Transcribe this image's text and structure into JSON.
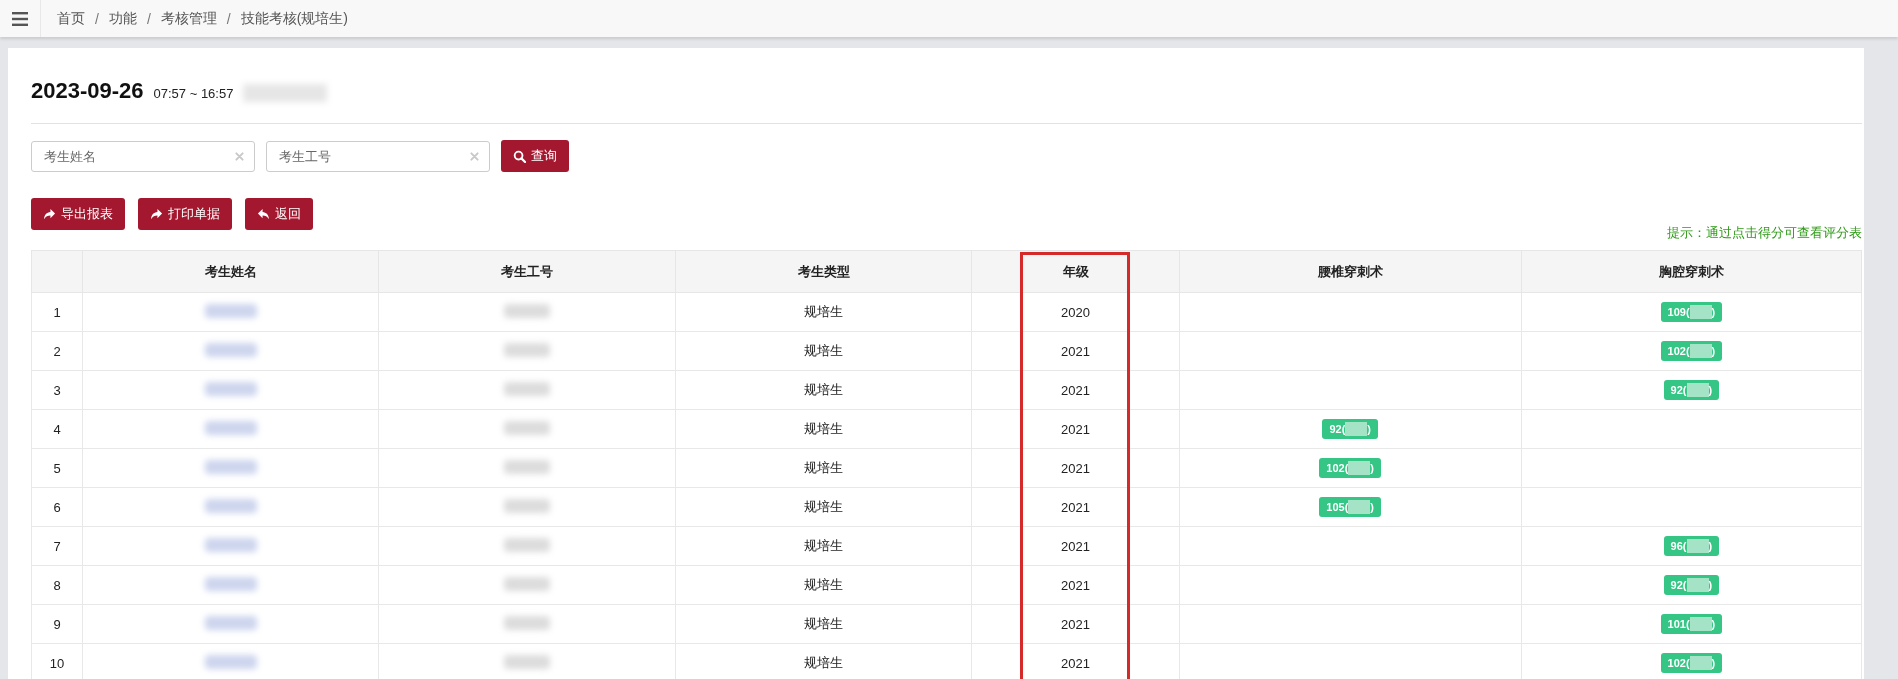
{
  "breadcrumb": [
    {
      "label": "首页"
    },
    {
      "separator": "/",
      "label": "功能"
    },
    {
      "separator": "/",
      "label": "考核管理"
    },
    {
      "separator": "/",
      "label": "技能考核(规培生)"
    }
  ],
  "header": {
    "date": "2023-09-26",
    "time_range": "07:57 ~ 16:57",
    "subtitle_redacted": true
  },
  "search": {
    "fields": [
      {
        "placeholder": "考生姓名"
      },
      {
        "placeholder": "考生工号"
      }
    ],
    "button": {
      "label": "查询"
    }
  },
  "actions": [
    {
      "label": "导出报表"
    },
    {
      "label": "打印单据"
    },
    {
      "label": "返回"
    }
  ],
  "hint": "提示：通过点击得分可查看评分表",
  "table": {
    "columns": [
      {
        "highlighted": false
      },
      {
        "label": "考生姓名",
        "highlighted": false
      },
      {
        "label": "考生工号",
        "highlighted": false
      },
      {
        "label": "考生类型",
        "highlighted": false
      },
      {
        "label": "年级",
        "highlighted": true
      },
      {
        "label": "腰椎穿刺术",
        "highlighted": false
      },
      {
        "label": "胸腔穿刺术",
        "highlighted": false
      }
    ],
    "rows": [
      {
        "cells": [
          {
            "kind": "text",
            "text": "1"
          },
          {
            "kind": "redacted"
          },
          {
            "kind": "redacted"
          },
          {
            "kind": "text",
            "text": "规培生"
          },
          {
            "kind": "text",
            "text": "2020"
          },
          {
            "kind": "blank"
          },
          {
            "kind": "score",
            "prefix": "109(",
            "suffix": ")"
          }
        ]
      },
      {
        "cells": [
          {
            "kind": "text",
            "text": "2"
          },
          {
            "kind": "redacted"
          },
          {
            "kind": "redacted"
          },
          {
            "kind": "text",
            "text": "规培生"
          },
          {
            "kind": "text",
            "text": "2021"
          },
          {
            "kind": "blank"
          },
          {
            "kind": "score",
            "prefix": "102(",
            "suffix": ")"
          }
        ]
      },
      {
        "cells": [
          {
            "kind": "text",
            "text": "3"
          },
          {
            "kind": "redacted"
          },
          {
            "kind": "redacted"
          },
          {
            "kind": "text",
            "text": "规培生"
          },
          {
            "kind": "text",
            "text": "2021"
          },
          {
            "kind": "blank"
          },
          {
            "kind": "score",
            "prefix": "92(",
            "suffix": ")"
          }
        ]
      },
      {
        "cells": [
          {
            "kind": "text",
            "text": "4"
          },
          {
            "kind": "redacted"
          },
          {
            "kind": "redacted"
          },
          {
            "kind": "text",
            "text": "规培生"
          },
          {
            "kind": "text",
            "text": "2021"
          },
          {
            "kind": "score",
            "prefix": "92(",
            "suffix": ")"
          },
          {
            "kind": "blank"
          }
        ]
      },
      {
        "cells": [
          {
            "kind": "text",
            "text": "5"
          },
          {
            "kind": "redacted"
          },
          {
            "kind": "redacted"
          },
          {
            "kind": "text",
            "text": "规培生"
          },
          {
            "kind": "text",
            "text": "2021"
          },
          {
            "kind": "score",
            "prefix": "102(",
            "suffix": ")"
          },
          {
            "kind": "blank"
          }
        ]
      },
      {
        "cells": [
          {
            "kind": "text",
            "text": "6"
          },
          {
            "kind": "redacted"
          },
          {
            "kind": "redacted"
          },
          {
            "kind": "text",
            "text": "规培生"
          },
          {
            "kind": "text",
            "text": "2021"
          },
          {
            "kind": "score",
            "prefix": "105(",
            "suffix": ")"
          },
          {
            "kind": "blank"
          }
        ]
      },
      {
        "cells": [
          {
            "kind": "text",
            "text": "7"
          },
          {
            "kind": "redacted"
          },
          {
            "kind": "redacted"
          },
          {
            "kind": "text",
            "text": "规培生"
          },
          {
            "kind": "text",
            "text": "2021"
          },
          {
            "kind": "blank"
          },
          {
            "kind": "score",
            "prefix": "96(",
            "suffix": ")"
          }
        ]
      },
      {
        "cells": [
          {
            "kind": "text",
            "text": "8"
          },
          {
            "kind": "redacted"
          },
          {
            "kind": "redacted"
          },
          {
            "kind": "text",
            "text": "规培生"
          },
          {
            "kind": "text",
            "text": "2021"
          },
          {
            "kind": "blank"
          },
          {
            "kind": "score",
            "prefix": "92(",
            "suffix": ")"
          }
        ]
      },
      {
        "cells": [
          {
            "kind": "text",
            "text": "9"
          },
          {
            "kind": "redacted"
          },
          {
            "kind": "redacted"
          },
          {
            "kind": "text",
            "text": "规培生"
          },
          {
            "kind": "text",
            "text": "2021"
          },
          {
            "kind": "blank"
          },
          {
            "kind": "score",
            "prefix": "101(",
            "suffix": ")"
          }
        ]
      },
      {
        "cells": [
          {
            "kind": "text",
            "text": "10"
          },
          {
            "kind": "redacted"
          },
          {
            "kind": "redacted"
          },
          {
            "kind": "text",
            "text": "规培生"
          },
          {
            "kind": "text",
            "text": "2021"
          },
          {
            "kind": "blank"
          },
          {
            "kind": "score",
            "prefix": "102(",
            "suffix": ")"
          }
        ]
      }
    ]
  }
}
